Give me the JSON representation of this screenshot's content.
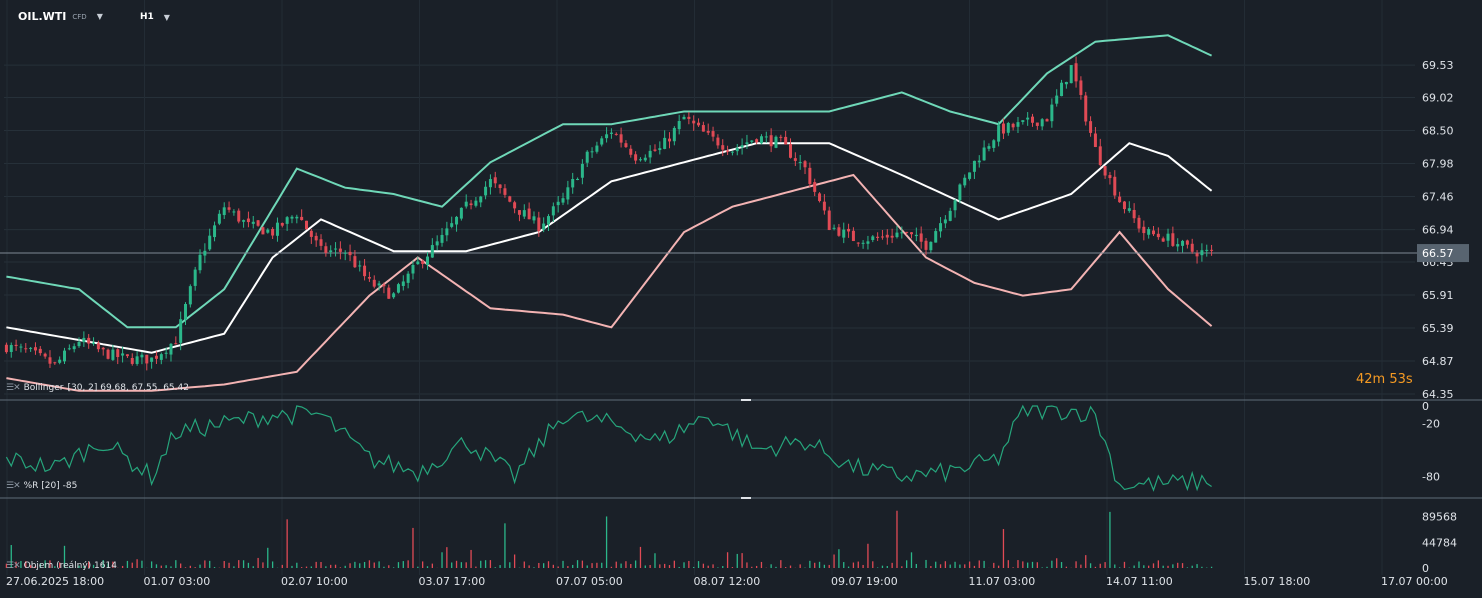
{
  "header": {
    "symbol": "OIL.WTI",
    "symbol_type": "CFD",
    "timeframe": "H1"
  },
  "timer": {
    "minutes": "42",
    "m_unit": "m",
    "seconds": "53",
    "s_unit": "s"
  },
  "indicators": {
    "bollinger_label": "Bollinger",
    "bollinger_values": "[30, 2] 69.68, 67.55, 65.42",
    "wr_label": "%R [20] -85",
    "volume_label": "Objem (reálný) 1614"
  },
  "colors": {
    "background": "#1a2028",
    "up": "#2bb78a",
    "down": "#e04a55",
    "upper_band": "#6fd8b8",
    "middle_band": "#ffffff",
    "lower_band": "#f3b3b3",
    "wr_line": "#26a57c",
    "price_tag_bg": "#586470",
    "timer": "#f59a23"
  },
  "chart_data": [
    {
      "type": "candlestick",
      "title": "OIL.WTI",
      "price_axis_ticks": [
        "69.53",
        "69.02",
        "68.50",
        "67.98",
        "67.46",
        "66.94",
        "66.43",
        "65.91",
        "65.39",
        "64.87",
        "64.35"
      ],
      "current_price": "66.57",
      "ylim": [
        64.35,
        69.8
      ],
      "time_axis_labels": [
        "27.06.2025 18:00",
        "01.07 03:00",
        "02.07 10:00",
        "03.07 17:00",
        "07.07 05:00",
        "08.07 12:00",
        "09.07 19:00",
        "11.07 03:00",
        "14.07 11:00",
        "15.07 18:00",
        "17.07 00:00"
      ],
      "close_path": [
        [
          0,
          65.1
        ],
        [
          5,
          65.0
        ],
        [
          10,
          64.8
        ],
        [
          15,
          65.2
        ],
        [
          20,
          65.0
        ],
        [
          25,
          64.9
        ],
        [
          30,
          64.9
        ],
        [
          35,
          65.2
        ],
        [
          40,
          66.5
        ],
        [
          45,
          67.3
        ],
        [
          50,
          67.0
        ],
        [
          55,
          66.9
        ],
        [
          60,
          67.2
        ],
        [
          65,
          66.6
        ],
        [
          70,
          66.6
        ],
        [
          75,
          66.1
        ],
        [
          80,
          65.9
        ],
        [
          85,
          66.4
        ],
        [
          90,
          66.8
        ],
        [
          95,
          67.3
        ],
        [
          100,
          67.7
        ],
        [
          105,
          67.3
        ],
        [
          110,
          67.0
        ],
        [
          115,
          67.4
        ],
        [
          120,
          68.1
        ],
        [
          125,
          68.5
        ],
        [
          130,
          68.1
        ],
        [
          135,
          68.2
        ],
        [
          140,
          68.7
        ],
        [
          145,
          68.4
        ],
        [
          150,
          68.2
        ],
        [
          155,
          68.4
        ],
        [
          160,
          68.3
        ],
        [
          165,
          67.9
        ],
        [
          170,
          67.0
        ],
        [
          175,
          66.8
        ],
        [
          180,
          66.8
        ],
        [
          185,
          66.9
        ],
        [
          190,
          66.7
        ],
        [
          195,
          67.3
        ],
        [
          200,
          68.0
        ],
        [
          205,
          68.5
        ],
        [
          210,
          68.6
        ],
        [
          215,
          68.7
        ],
        [
          220,
          69.5
        ],
        [
          225,
          68.2
        ],
        [
          230,
          67.4
        ],
        [
          235,
          66.9
        ],
        [
          240,
          66.8
        ],
        [
          245,
          66.6
        ],
        [
          249,
          66.57
        ]
      ],
      "upper_band": [
        [
          0,
          66.2
        ],
        [
          15,
          66.0
        ],
        [
          25,
          65.4
        ],
        [
          35,
          65.4
        ],
        [
          45,
          66.0
        ],
        [
          60,
          67.9
        ],
        [
          70,
          67.6
        ],
        [
          80,
          67.5
        ],
        [
          90,
          67.3
        ],
        [
          100,
          68.0
        ],
        [
          115,
          68.6
        ],
        [
          125,
          68.6
        ],
        [
          140,
          68.8
        ],
        [
          160,
          68.8
        ],
        [
          170,
          68.8
        ],
        [
          185,
          69.1
        ],
        [
          195,
          68.8
        ],
        [
          205,
          68.6
        ],
        [
          215,
          69.4
        ],
        [
          225,
          69.9
        ],
        [
          240,
          70.0
        ],
        [
          249,
          69.68
        ]
      ],
      "middle_band": [
        [
          0,
          65.4
        ],
        [
          15,
          65.2
        ],
        [
          30,
          65.0
        ],
        [
          45,
          65.3
        ],
        [
          55,
          66.5
        ],
        [
          65,
          67.1
        ],
        [
          80,
          66.6
        ],
        [
          95,
          66.6
        ],
        [
          110,
          66.9
        ],
        [
          125,
          67.7
        ],
        [
          140,
          68.0
        ],
        [
          155,
          68.3
        ],
        [
          170,
          68.3
        ],
        [
          185,
          67.8
        ],
        [
          205,
          67.1
        ],
        [
          220,
          67.5
        ],
        [
          232,
          68.3
        ],
        [
          240,
          68.1
        ],
        [
          249,
          67.55
        ]
      ],
      "lower_band": [
        [
          0,
          64.6
        ],
        [
          15,
          64.4
        ],
        [
          30,
          64.4
        ],
        [
          45,
          64.5
        ],
        [
          60,
          64.7
        ],
        [
          75,
          65.9
        ],
        [
          85,
          66.5
        ],
        [
          100,
          65.7
        ],
        [
          115,
          65.6
        ],
        [
          125,
          65.4
        ],
        [
          140,
          66.9
        ],
        [
          150,
          67.3
        ],
        [
          160,
          67.5
        ],
        [
          175,
          67.8
        ],
        [
          190,
          66.5
        ],
        [
          200,
          66.1
        ],
        [
          210,
          65.9
        ],
        [
          220,
          66.0
        ],
        [
          230,
          66.9
        ],
        [
          240,
          66.0
        ],
        [
          249,
          65.42
        ]
      ]
    },
    {
      "type": "line",
      "title": "%R [20]",
      "ylim": [
        -100,
        0
      ],
      "y_ticks": [
        "0",
        "-20",
        "-80"
      ],
      "values_path": [
        [
          0,
          -60
        ],
        [
          10,
          -70
        ],
        [
          20,
          -40
        ],
        [
          30,
          -80
        ],
        [
          35,
          -30
        ],
        [
          45,
          -20
        ],
        [
          55,
          -10
        ],
        [
          65,
          -10
        ],
        [
          75,
          -60
        ],
        [
          85,
          -75
        ],
        [
          95,
          -40
        ],
        [
          105,
          -80
        ],
        [
          115,
          -10
        ],
        [
          125,
          -20
        ],
        [
          135,
          -40
        ],
        [
          145,
          -10
        ],
        [
          155,
          -50
        ],
        [
          165,
          -40
        ],
        [
          175,
          -70
        ],
        [
          185,
          -80
        ],
        [
          195,
          -75
        ],
        [
          205,
          -60
        ],
        [
          210,
          -5
        ],
        [
          220,
          -5
        ],
        [
          225,
          -10
        ],
        [
          230,
          -90
        ],
        [
          240,
          -88
        ],
        [
          249,
          -85
        ]
      ]
    },
    {
      "type": "bar",
      "title": "Objem (reálný)",
      "ylim": [
        0,
        110000
      ],
      "y_ticks": [
        "89568",
        "44784",
        "0"
      ],
      "spike_bars": [
        [
          58,
          85000
        ],
        [
          84,
          70000
        ],
        [
          103,
          78000
        ],
        [
          124,
          90000
        ],
        [
          184,
          100000
        ],
        [
          206,
          68000
        ],
        [
          228,
          98000
        ]
      ]
    }
  ]
}
